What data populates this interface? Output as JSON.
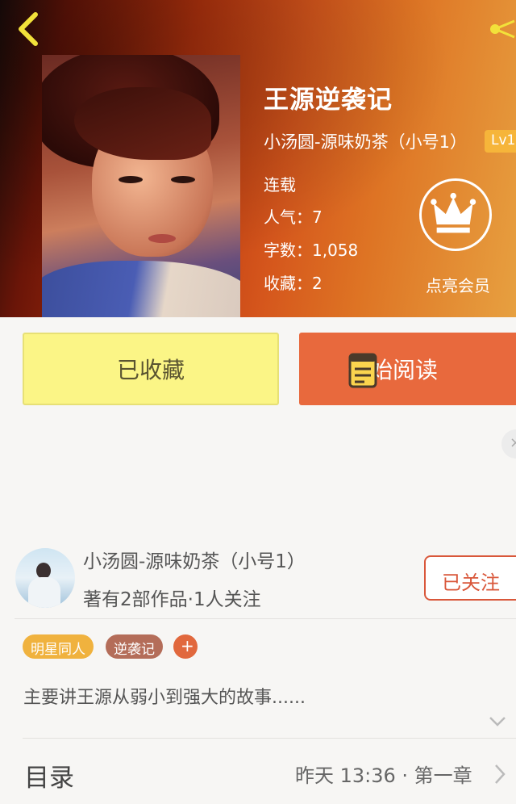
{
  "header": {
    "back_icon": "chevron-left-icon",
    "share_icon": "share-icon"
  },
  "book": {
    "title": "王源逆袭记",
    "author_line": "小汤圆-源味奶茶（小号1）",
    "level_badge": "Lv1",
    "status": "连载",
    "popularity": "人气：7",
    "word_count": "字数：1,058",
    "favorites": "收藏：2"
  },
  "vip": {
    "icon": "crown-icon",
    "label": "点亮会员"
  },
  "actions": {
    "collected_label": "已收藏",
    "read_label": "开始阅读",
    "read_icon": "book-icon"
  },
  "author": {
    "name": "小汤圆-源味奶茶（小号1）",
    "stats": "著有2部作品·1人关注",
    "follow_label": "已关注"
  },
  "tags": {
    "items": [
      "明星同人",
      "逆袭记"
    ],
    "add_label": "+"
  },
  "description": "主要讲王源从弱小到强大的故事......",
  "toc": {
    "title": "目录",
    "latest": "昨天 13:36 · 第一章"
  },
  "colors": {
    "accent_orange": "#e8693d",
    "collected_yellow": "#fbf586",
    "badge_gold": "#f6b53a",
    "follow_red": "#d9573a"
  }
}
